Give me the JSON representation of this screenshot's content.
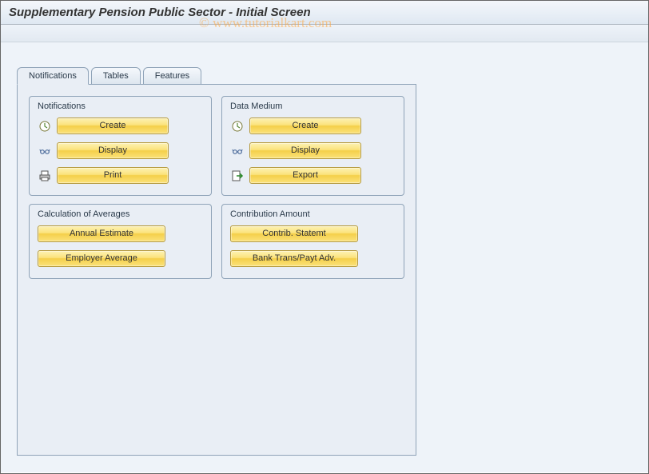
{
  "page": {
    "title": "Supplementary Pension Public Sector - Initial Screen"
  },
  "watermark": "© www.tutorialkart.com",
  "tabs": {
    "items": [
      "Notifications",
      "Tables",
      "Features"
    ],
    "active": 0
  },
  "groups": {
    "notifications": {
      "title": "Notifications",
      "create": "Create",
      "display": "Display",
      "print": "Print"
    },
    "data_medium": {
      "title": "Data Medium",
      "create": "Create",
      "display": "Display",
      "export": "Export"
    },
    "calc_averages": {
      "title": "Calculation of Averages",
      "annual_estimate": "Annual Estimate",
      "employer_average": "Employer Average"
    },
    "contribution": {
      "title": "Contribution Amount",
      "contrib_statemt": "Contrib. Statemt",
      "bank_trans": "Bank Trans/Payt Adv."
    }
  }
}
